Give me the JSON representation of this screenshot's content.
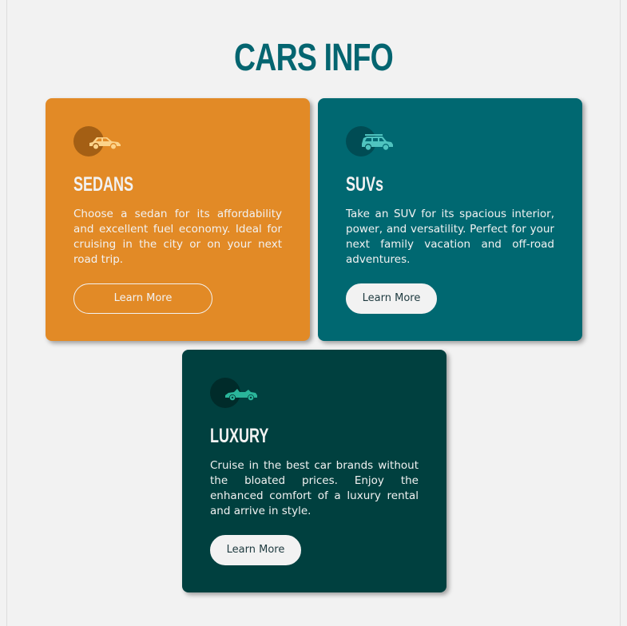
{
  "page": {
    "title": "CARS INFO",
    "colors": {
      "background": "#f2f2f2",
      "title": "#046570",
      "text_light": "#f2f2f2"
    }
  },
  "cards": [
    {
      "id": "sedans",
      "title": "SEDANS",
      "text": "Choose a sedan for its affordability and excellent fuel economy. Ideal for cruising in the city or on your next road trip.",
      "button_label": "Learn More",
      "icon": "sedan-car-icon",
      "color": "#e28a26",
      "icon_color": "#fcd38a",
      "icon_circle_color": "#a45f14",
      "button_style": "outline"
    },
    {
      "id": "suvs",
      "title": "SUVs",
      "text": "Take an SUV for its spacious interior, power, and versatility. Perfect for your next family vacation and off-road adventures.",
      "button_label": "Learn More",
      "icon": "suv-car-icon",
      "color": "#006871",
      "icon_color": "#4fc3bf",
      "icon_circle_color": "#004c54",
      "button_style": "solid"
    },
    {
      "id": "luxury",
      "title": "LUXURY",
      "text": "Cruise in the best car brands without the bloated prices. Enjoy the enhanced comfort of a luxury rental and arrive in style.",
      "button_label": "Learn More",
      "icon": "luxury-car-icon",
      "color": "#00403f",
      "icon_color": "#2ab59a",
      "icon_circle_color": "#002b2a",
      "button_style": "solid"
    }
  ]
}
